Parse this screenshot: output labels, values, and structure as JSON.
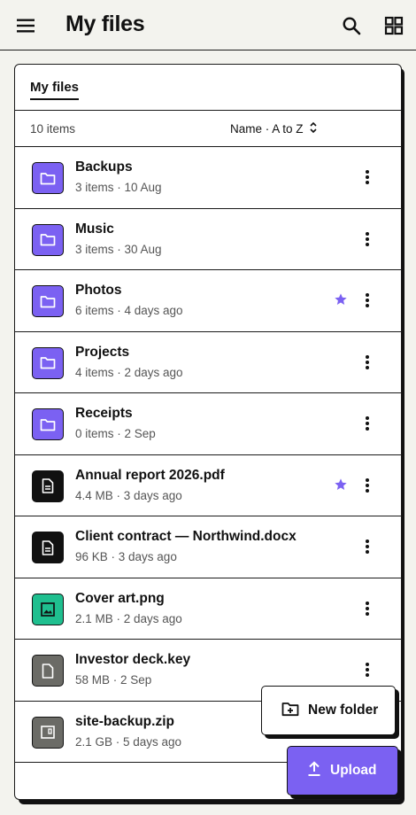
{
  "appbar": {
    "title": "My files"
  },
  "tabs": {
    "active": "My files"
  },
  "list": {
    "count": "10 items",
    "sort": "Name · A to Z",
    "items": [
      {
        "name": "Backups",
        "meta": "3 items · 10 Aug",
        "type": "folder",
        "starred": false
      },
      {
        "name": "Music",
        "meta": "3 items · 30 Aug",
        "type": "folder",
        "starred": false
      },
      {
        "name": "Photos",
        "meta": "6 items · 4 days ago",
        "type": "folder",
        "starred": true
      },
      {
        "name": "Projects",
        "meta": "4 items · 2 days ago",
        "type": "folder",
        "starred": false
      },
      {
        "name": "Receipts",
        "meta": "0 items · 2 Sep",
        "type": "folder",
        "starred": false
      },
      {
        "name": "Annual report 2026.pdf",
        "meta": "4.4 MB · 3 days ago",
        "type": "document",
        "starred": true
      },
      {
        "name": "Client contract — Northwind.docx",
        "meta": "96 KB · 3 days ago",
        "type": "document",
        "starred": false
      },
      {
        "name": "Cover art.png",
        "meta": "2.1 MB · 2 days ago",
        "type": "image",
        "starred": false
      },
      {
        "name": "Investor deck.key",
        "meta": "58 MB · 2 Sep",
        "type": "file",
        "starred": false
      },
      {
        "name": "site-backup.zip",
        "meta": "2.1 GB · 5 days ago",
        "type": "archive",
        "starred": false
      }
    ]
  },
  "actions": {
    "new_folder": "New folder",
    "upload": "Upload"
  },
  "colors": {
    "folder": "#7b61f2",
    "document": "#111111",
    "image": "#1fbf8f",
    "file": "#6b6b66",
    "archive": "#6b6b66",
    "star": "#7b61f2",
    "accent": "#7b61f2"
  },
  "icons": {
    "folder": "folder-icon",
    "document": "document-icon",
    "image": "image-icon",
    "file": "file-icon",
    "archive": "archive-icon"
  }
}
